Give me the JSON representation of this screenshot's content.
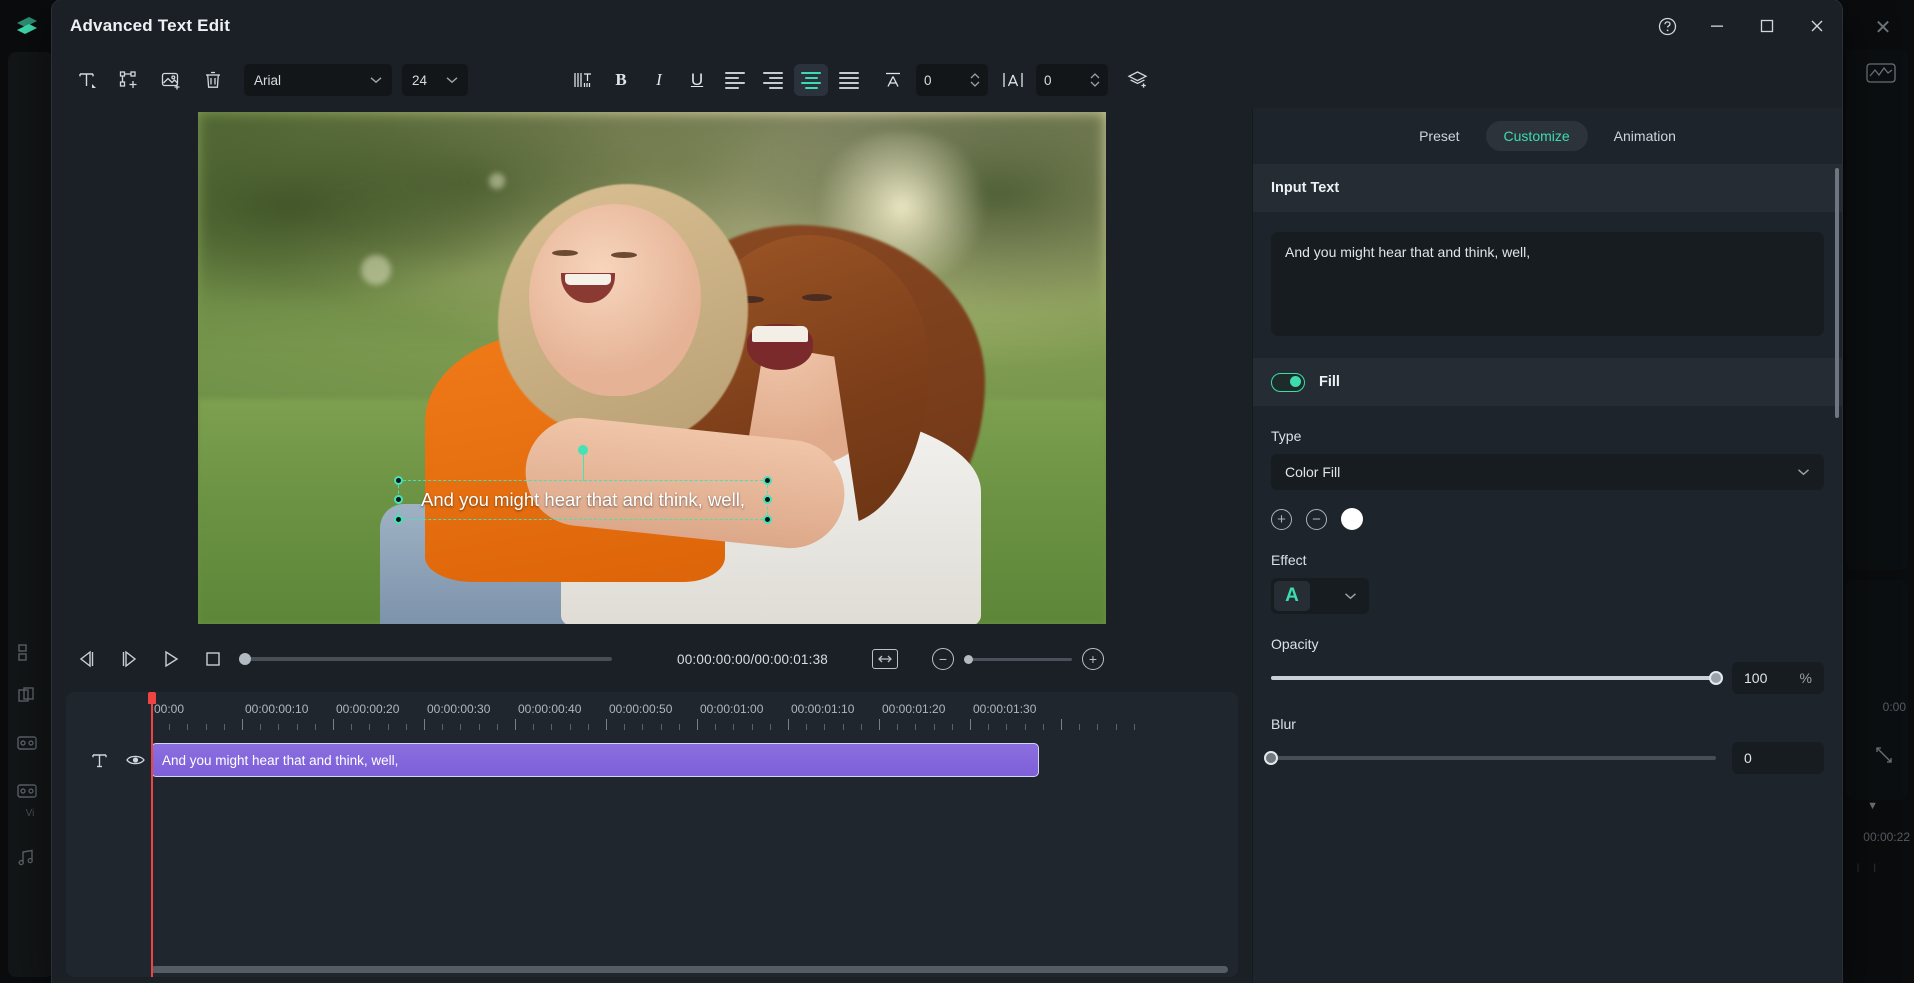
{
  "background": {
    "logo_icon": "wondershare-logo-icon",
    "rail_icons": [
      "media-icon",
      "stickers-icon",
      "video-icon",
      "video2-icon",
      "audio-icon"
    ],
    "rail_label": "Vi",
    "chart_icon": "waveform-icon",
    "time_small": "0:00",
    "time_ruler": "00:00:22",
    "close_icon": "close-icon"
  },
  "window": {
    "title": "Advanced Text Edit",
    "help_icon": "help-icon",
    "minimize_icon": "minimize-icon",
    "maximize_icon": "maximize-icon",
    "close_icon": "close-icon"
  },
  "toolbar": {
    "add_text_icon": "add-text-icon",
    "transform_icon": "transform-icon",
    "add_image_icon": "add-image-icon",
    "delete_icon": "delete-icon",
    "font_family": "Arial",
    "font_size": "24",
    "text_direction_icon": "vertical-text-icon",
    "bold_label": "B",
    "italic_label": "I",
    "underline_label": "U",
    "align_left_icon": "align-left-icon",
    "align_center_icon": "align-center-icon",
    "align_justify_icon": "align-justify-icon",
    "align_right_icon": "align-right-icon",
    "line_spacing_icon": "line-spacing-icon",
    "line_spacing_value": "0",
    "letter_spacing_icon": "letter-spacing-icon",
    "letter_spacing_value": "0",
    "layers_icon": "layers-icon",
    "active_alignment": "align-justify-icon"
  },
  "preview": {
    "overlay_text": "And you might hear that and think, well,"
  },
  "player": {
    "prev_frame_icon": "previous-frame-icon",
    "next_frame_icon": "next-frame-icon",
    "play_icon": "play-icon",
    "stop_icon": "stop-icon",
    "timecode": "00:00:00:00/00:00:01:38",
    "fit_icon": "fit-to-screen-icon",
    "zoom_out_icon": "zoom-out-icon",
    "zoom_in_icon": "zoom-in-icon"
  },
  "timeline": {
    "ruler_labels": [
      "00:00",
      "00:00:00:10",
      "00:00:00:20",
      "00:00:00:30",
      "00:00:00:40",
      "00:00:00:50",
      "00:00:01:00",
      "00:00:01:10",
      "00:00:01:20",
      "00:00:01:30"
    ],
    "track_type_icon": "text-track-icon",
    "visibility_icon": "eye-icon",
    "clip_label": "And you might hear that and think, well,"
  },
  "right_panel": {
    "tabs": [
      {
        "label": "Preset",
        "active": false
      },
      {
        "label": "Customize",
        "active": true
      },
      {
        "label": "Animation",
        "active": false
      }
    ],
    "input_text_header": "Input Text",
    "input_text_value": "And you might hear that and think, well,",
    "fill_label": "Fill",
    "fill_enabled": true,
    "type_label": "Type",
    "type_value": "Color Fill",
    "add_color_icon": "add-circle-icon",
    "remove_color_icon": "remove-circle-icon",
    "color_swatch": "#ffffff",
    "effect_label": "Effect",
    "effect_glyph": "A",
    "opacity_label": "Opacity",
    "opacity_value": "100",
    "opacity_unit": "%",
    "blur_label": "Blur",
    "blur_value": "0"
  },
  "colors": {
    "accent": "#3ddcae",
    "clip": "#7d5fd8",
    "playhead": "#ef4444",
    "panel": "#1e242b",
    "window": "#1b2026"
  }
}
